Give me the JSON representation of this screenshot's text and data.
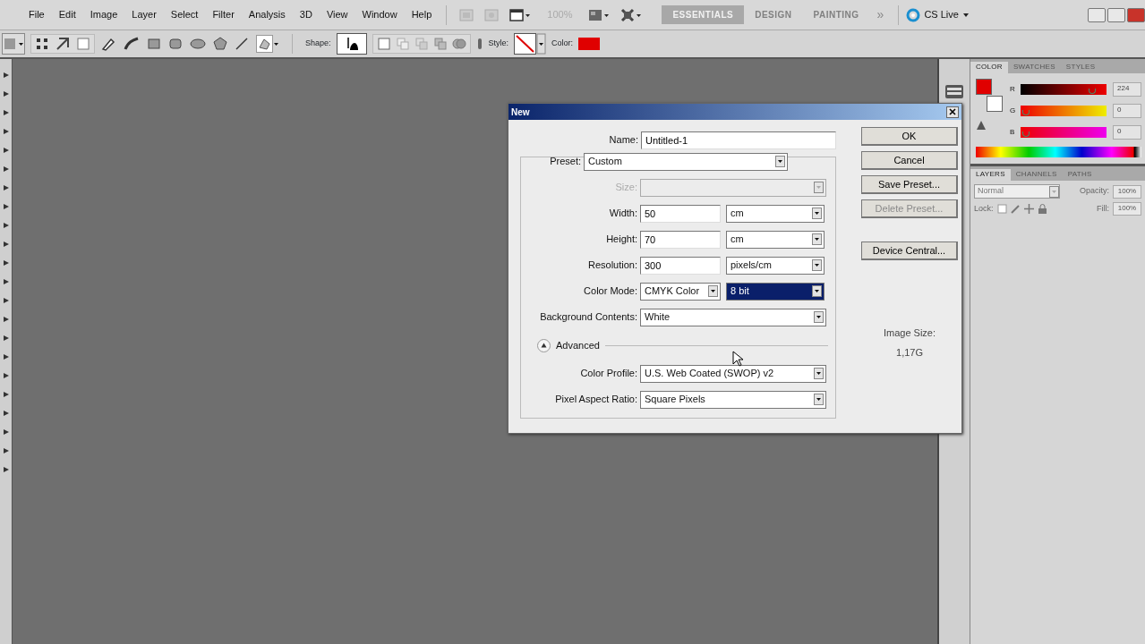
{
  "menu_bar": {
    "items": [
      "File",
      "Edit",
      "Image",
      "Layer",
      "Select",
      "Filter",
      "Analysis",
      "3D",
      "View",
      "Window",
      "Help"
    ],
    "zoom": "100%",
    "workspaces": [
      {
        "label": "ESSENTIALS",
        "selected": true
      },
      {
        "label": "DESIGN",
        "selected": false
      },
      {
        "label": "PAINTING",
        "selected": false
      }
    ],
    "more": "»",
    "cs_live": "CS Live"
  },
  "options_bar": {
    "shape_label": "Shape:",
    "style_label": "Style:",
    "color_label": "Color:",
    "color": "#e00000"
  },
  "dialog": {
    "title": "New",
    "name_row": {
      "label": "Name:",
      "kind": "text",
      "value": "Untitled-1"
    },
    "rows": [
      {
        "label": "Preset:",
        "kind": "select",
        "value": "Custom",
        "disabled": false
      },
      {
        "label": "Size:",
        "kind": "select",
        "disabled": true
      },
      {
        "label": "Width:",
        "kind": "number",
        "value": "50",
        "unit": "cm",
        "unit_selected": false,
        "disabled": false
      },
      {
        "label": "Height:",
        "kind": "number",
        "value": "70",
        "unit": "cm",
        "unit_selected": false,
        "disabled": false
      },
      {
        "label": "Resolution:",
        "kind": "number",
        "value": "300",
        "unit": "pixels/cm",
        "unit_selected": false,
        "disabled": false
      },
      {
        "label": "Color Mode:",
        "kind": "number",
        "value": "CMYK Color",
        "unit": "8 bit",
        "unit_selected": true,
        "disabled": false
      },
      {
        "label": "Background Contents:",
        "kind": "select",
        "value": "White",
        "disabled": false
      }
    ],
    "advanced": {
      "label": "Advanced",
      "expanded": true
    },
    "advanced_rows": [
      {
        "label": "Color Profile:",
        "kind": "select",
        "value": "U.S. Web Coated (SWOP) v2",
        "disabled": false
      },
      {
        "label": "Pixel Aspect Ratio:",
        "kind": "select",
        "value": "Square Pixels",
        "disabled": false
      }
    ],
    "buttons": [
      {
        "label": "OK",
        "disabled": false
      },
      {
        "label": "Cancel",
        "disabled": false
      },
      {
        "label": "Save Preset...",
        "disabled": false
      },
      {
        "label": "Delete Preset...",
        "disabled": true
      },
      {
        "label": "Device Central...",
        "disabled": false
      }
    ],
    "image_size": {
      "label": "Image Size:",
      "value": "1,17G"
    }
  },
  "color_panel": {
    "tabs": [
      {
        "label": "COLOR",
        "selected": true
      },
      {
        "label": "SWATCHES",
        "selected": false
      },
      {
        "label": "STYLES",
        "selected": false
      }
    ],
    "swatches": [
      {
        "kind": "foreground",
        "color": "#e00000"
      },
      {
        "kind": "background",
        "color": "#ffffff"
      }
    ],
    "channels": [
      {
        "label": "R",
        "level": 0.86,
        "value": "224"
      },
      {
        "label": "G",
        "level": 0.02,
        "value": "0"
      },
      {
        "label": "B",
        "level": 0.02,
        "value": "0"
      }
    ]
  },
  "layers_panel": {
    "tabs": [
      {
        "label": "LAYERS",
        "selected": true
      },
      {
        "label": "CHANNELS",
        "selected": false
      },
      {
        "label": "PATHS",
        "selected": false
      }
    ],
    "blend_mode": "Normal",
    "opacity_label": "Opacity:",
    "opacity": "100%",
    "lock_label": "Lock:",
    "fill_label": "Fill:",
    "fill": "100%"
  }
}
